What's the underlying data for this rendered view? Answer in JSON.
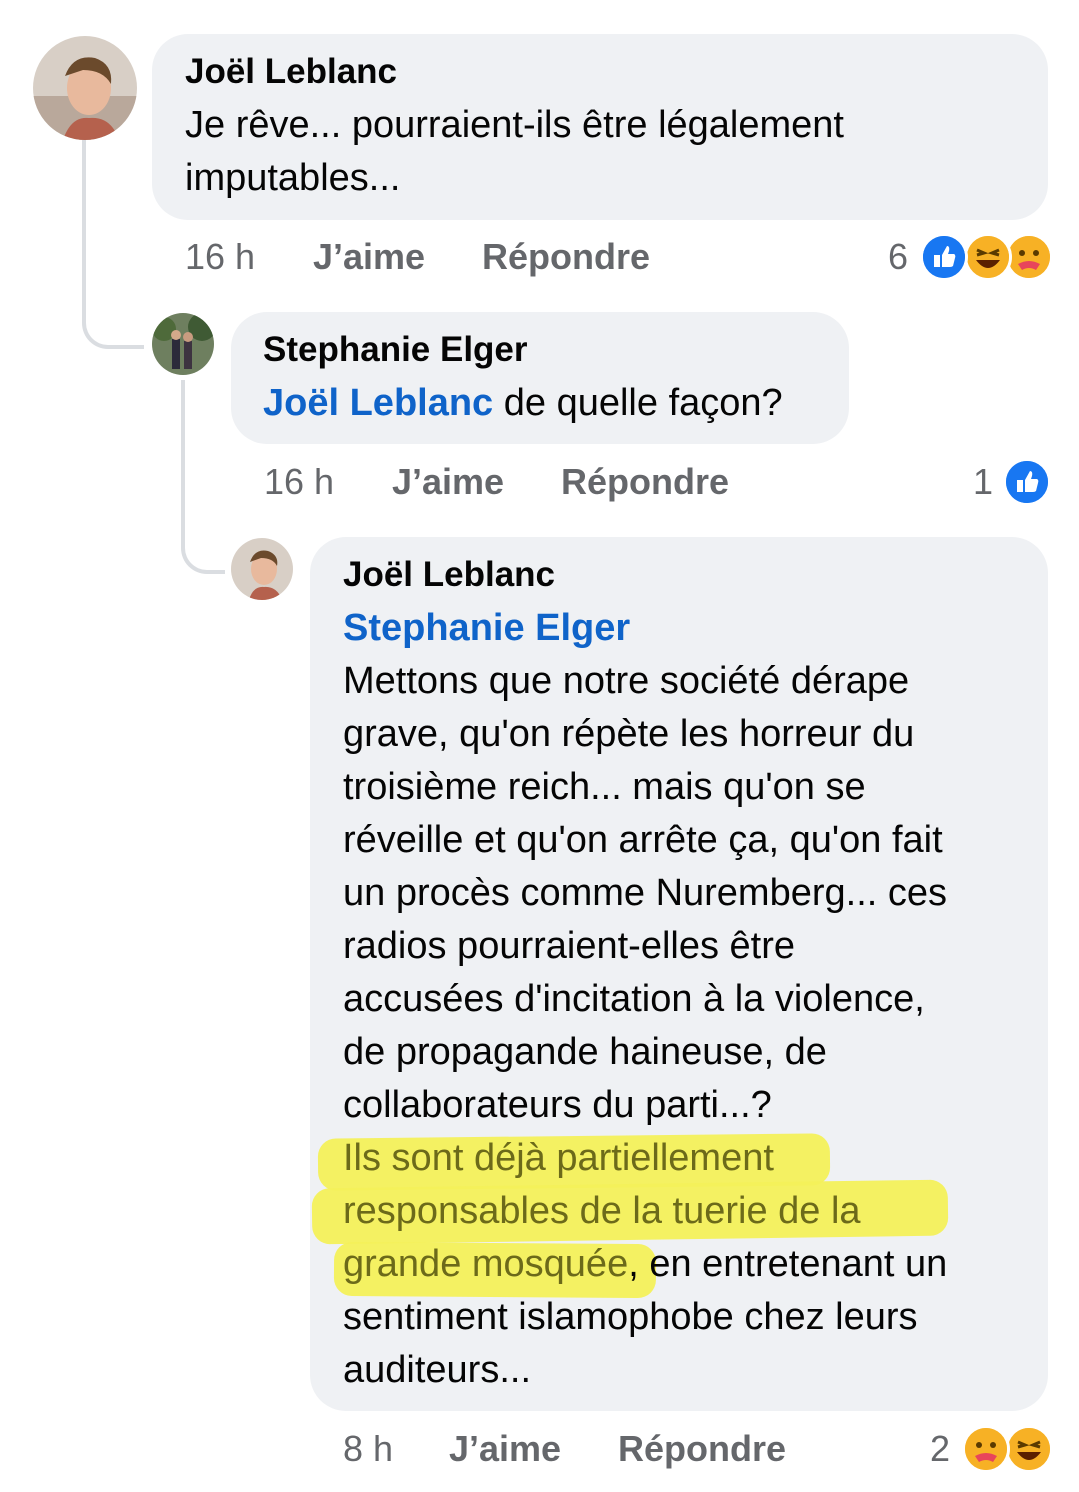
{
  "comments": [
    {
      "author": "Joël Leblanc",
      "lines": [
        "Je rêve... pourraient-ils être légalement",
        "imputables..."
      ],
      "time": "16 h",
      "like_label": "J’aime",
      "reply_label": "Répondre",
      "reaction_count": "6"
    },
    {
      "author": "Stephanie Elger",
      "mention": "Joël Leblanc",
      "text_after_mention": " de quelle façon?",
      "time": "16 h",
      "like_label": "J’aime",
      "reply_label": "Répondre",
      "reaction_count": "1"
    },
    {
      "author": "Joël Leblanc",
      "mention": "Stephanie Elger",
      "lines": [
        "Mettons que notre société dérape",
        "grave, qu'on répète les horreur du",
        "troisième reich... mais qu'on se",
        "réveille et qu'on arrête ça, qu'on fait",
        "un procès comme Nuremberg... ces",
        "radios pourraient-elles être",
        "accusées d'incitation à la violence,",
        "de propagande haineuse, de",
        "collaborateurs du parti...?"
      ],
      "highlighted_1": "Ils sont déjà partiellement",
      "highlighted_2": "responsables de la tuerie de la",
      "highlighted_3": "grande mosquée",
      "after_highlight": ", en entretenant un",
      "lines_end": [
        "sentiment islamophobe chez leurs",
        "auditeurs..."
      ],
      "time": "8 h",
      "like_label": "J’aime",
      "reply_label": "Répondre",
      "reaction_count": "2"
    }
  ],
  "colors": {
    "mention": "#0f63c9",
    "bubble": "#eff1f4",
    "meta": "#65676b",
    "highlight": "#f3f05a"
  },
  "icons": {
    "like": "like-reaction-icon",
    "haha": "haha-reaction-icon",
    "care": "care-reaction-icon"
  }
}
